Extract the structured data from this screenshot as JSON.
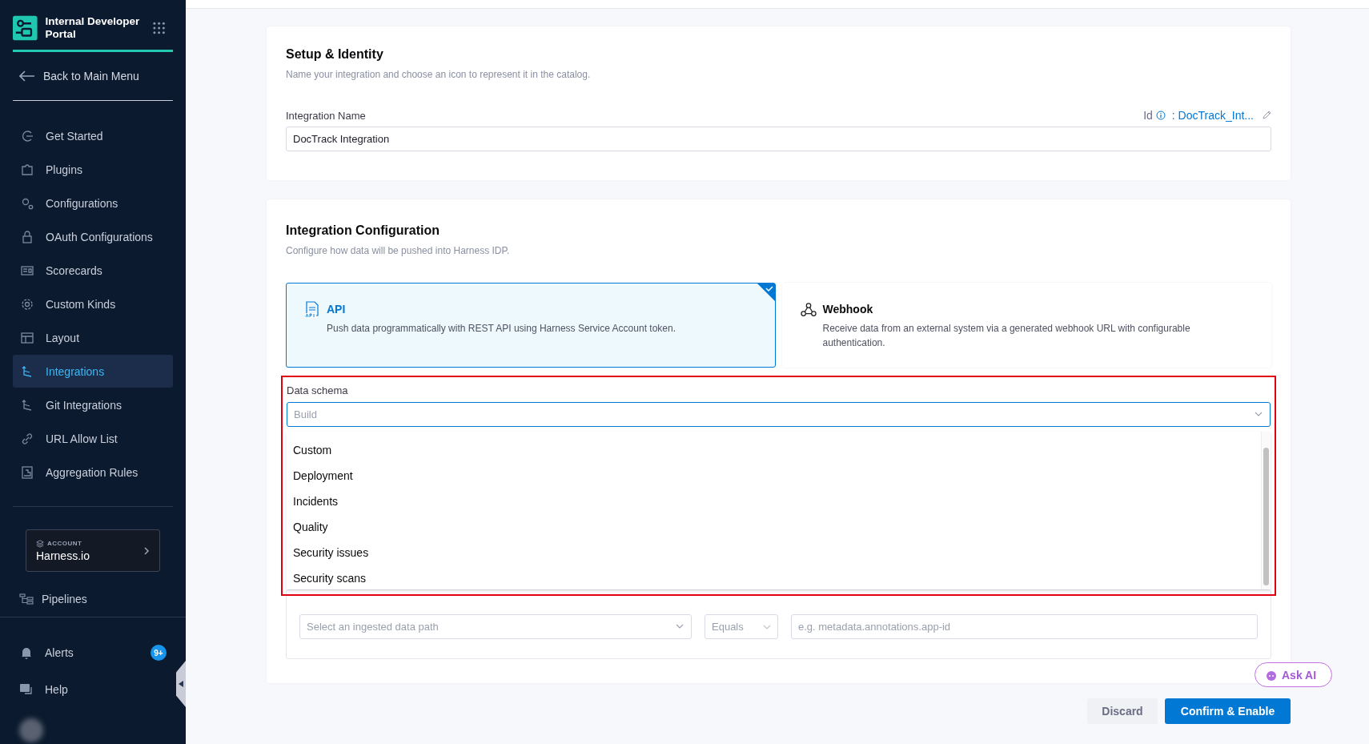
{
  "sidebar": {
    "title": "Internal Developer Portal",
    "back": "Back to Main Menu",
    "items": [
      {
        "label": "Get Started",
        "selected": false
      },
      {
        "label": "Plugins",
        "selected": false
      },
      {
        "label": "Configurations",
        "selected": false
      },
      {
        "label": "OAuth Configurations",
        "selected": false
      },
      {
        "label": "Scorecards",
        "selected": false
      },
      {
        "label": "Custom Kinds",
        "selected": false
      },
      {
        "label": "Layout",
        "selected": false
      },
      {
        "label": "Integrations",
        "selected": true
      },
      {
        "label": "Git Integrations",
        "selected": false
      },
      {
        "label": "URL Allow List",
        "selected": false
      },
      {
        "label": "Aggregation Rules",
        "selected": false
      }
    ],
    "account": {
      "label": "ACCOUNT",
      "name": "Harness.io"
    },
    "pipelines": "Pipelines",
    "alerts": {
      "label": "Alerts",
      "badge": "9+"
    },
    "help": "Help"
  },
  "setup": {
    "title": "Setup & Identity",
    "subtitle": "Name your integration and choose an icon to represent it in the catalog.",
    "field_label": "Integration Name",
    "id_label": "Id",
    "id_value": ": DocTrack_Int...",
    "value": "DocTrack Integration"
  },
  "config": {
    "title": "Integration Configuration",
    "subtitle": "Configure how data will be pushed into Harness IDP.",
    "methods": [
      {
        "title": "API",
        "description": "Push data programmatically with REST API using Harness Service Account token.",
        "selected": true
      },
      {
        "title": "Webhook",
        "description": "Receive data from an external system via a generated webhook URL with configurable authentication.",
        "selected": false
      }
    ],
    "schema": {
      "label": "Data schema",
      "placeholder": "Build",
      "options": [
        "Custom",
        "Deployment",
        "Incidents",
        "Quality",
        "Security issues",
        "Security scans"
      ]
    },
    "filter": {
      "path_placeholder": "Select an ingested data path",
      "operator": "Equals",
      "value_placeholder": "e.g. metadata.annotations.app-id"
    }
  },
  "actions": {
    "discard": "Discard",
    "confirm": "Confirm & Enable"
  },
  "ask_ai": "Ask AI"
}
